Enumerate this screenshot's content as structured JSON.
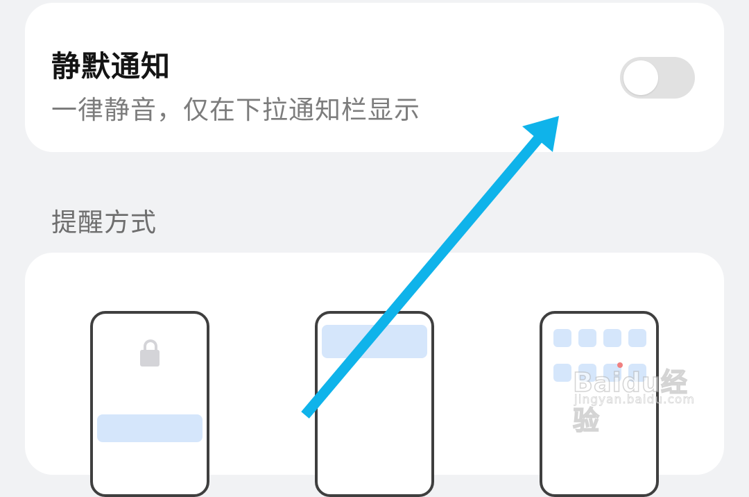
{
  "silent_notification": {
    "title": "静默通知",
    "description": "一律静音，仅在下拉通知栏显示",
    "toggle_on": false
  },
  "alert_style": {
    "header": "提醒方式",
    "options": [
      {
        "name": "lock-screen",
        "icon": "lock-icon"
      },
      {
        "name": "banner",
        "icon": "banner-icon"
      },
      {
        "name": "home-badge",
        "icon": "badge-icon"
      }
    ]
  },
  "colors": {
    "background": "#f1f2f4",
    "card": "#ffffff",
    "toggle_off": "#e1e1e1",
    "preview_accent": "#d5e6fb",
    "arrow": "#0fb3ea"
  },
  "watermark": {
    "logo": "Baidu经验",
    "url": "jingyan.baidu.com"
  }
}
